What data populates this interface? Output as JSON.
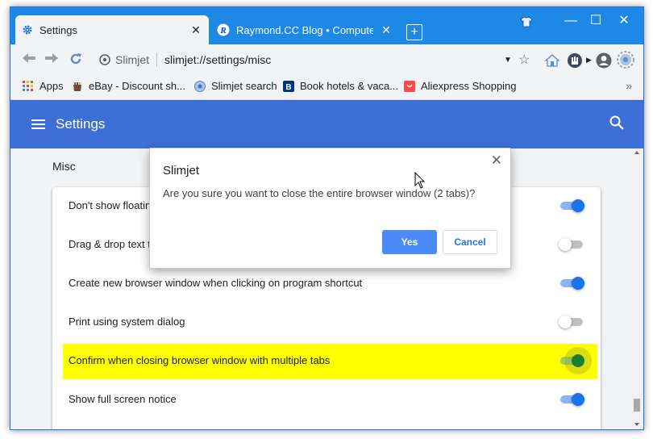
{
  "browser": {
    "tabs": [
      {
        "title": "Settings",
        "close": "✕",
        "icon": "gear-icon"
      },
      {
        "title": "Raymond.CC Blog • Computers Ma",
        "close": "✕",
        "icon": "raymond-icon"
      }
    ],
    "new_tab": "+",
    "window_controls": {
      "minimize": "—",
      "maximize": "☐",
      "close": "✕"
    },
    "omnibox": {
      "site": "Slimjet",
      "url": "slimjet://settings/misc"
    },
    "bookmarks": [
      {
        "label": "Apps",
        "icon": "apps-grid-icon"
      },
      {
        "label": "eBay - Discount sh...",
        "icon": "ebay-icon"
      },
      {
        "label": "Slimjet search",
        "icon": "slimjet-search-icon"
      },
      {
        "label": "Book hotels & vaca...",
        "icon": "booking-icon"
      },
      {
        "label": "Aliexpress Shopping",
        "icon": "aliexpress-icon"
      }
    ],
    "bookmarks_more": "»"
  },
  "settings": {
    "header_title": "Settings",
    "section_title": "Misc",
    "rows": [
      {
        "label": "Don't show floatin",
        "state": "on"
      },
      {
        "label": "Drag & drop text t",
        "state": "off"
      },
      {
        "label": "Create new browser window when clicking on program shortcut",
        "state": "on"
      },
      {
        "label": "Print using system dialog",
        "state": "off"
      },
      {
        "label": "Confirm when closing browser window with multiple tabs",
        "state": "on",
        "highlighted": true
      },
      {
        "label": "Show full screen notice",
        "state": "on"
      }
    ]
  },
  "dialog": {
    "title": "Slimjet",
    "message": "Are you sure you want to close the entire browser window (2 tabs)?",
    "yes": "Yes",
    "cancel": "Cancel",
    "close": "✕"
  },
  "colors": {
    "titlebar": "#1e88e5",
    "settings_header": "#3d6fd6",
    "toggle_on": "#1a73e8",
    "highlight": "#ffff00",
    "primary_button": "#4c8af5"
  }
}
